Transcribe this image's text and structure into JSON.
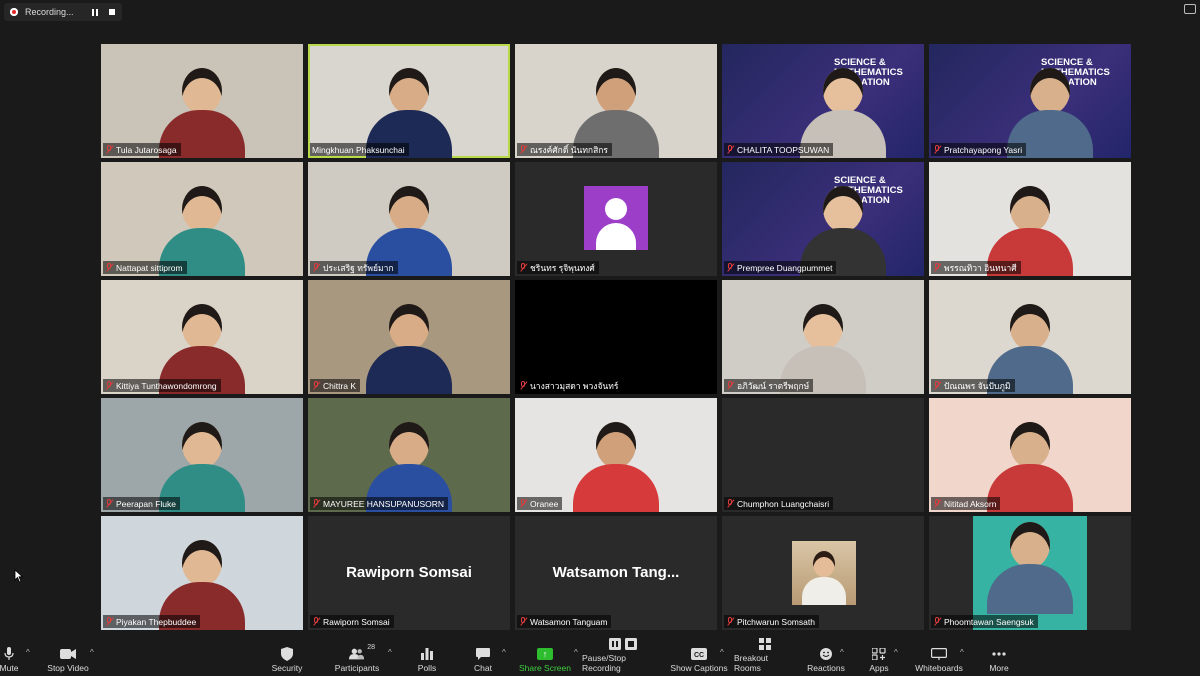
{
  "recording": {
    "label": "Recording..."
  },
  "tiles": [
    {
      "name": "Tula Jutarosaga",
      "muted": true,
      "bg": "#c9c3b8"
    },
    {
      "name": "Mingkhuan Phaksunchai",
      "muted": false,
      "bg": "#d9d6d0",
      "active": true
    },
    {
      "name": "ณรงค์ศักดิ์ นันทกสิกร",
      "muted": true,
      "bg": "#d8d4cc"
    },
    {
      "name": "CHALITA TOOPSUWAN",
      "muted": true,
      "bg": "#2c2f6e",
      "banner": true
    },
    {
      "name": "Pratchayapong Yasri",
      "muted": true,
      "bg": "#2c2f6e",
      "banner": true
    },
    {
      "name": "Nattapat sittiprom",
      "muted": true,
      "bg": "#cfc8bb"
    },
    {
      "name": "ประเสริฐ ทรัพย์มาก",
      "muted": true,
      "bg": "#cfcac2"
    },
    {
      "name": "ชรินทร รุจิพุนทงศ์",
      "muted": true,
      "bg": "#2a2a2a",
      "avatar": true
    },
    {
      "name": "Prempree Duangpummet",
      "muted": true,
      "bg": "#2c2f6e",
      "banner": true
    },
    {
      "name": "พรรณทิวา อินทนาศี",
      "muted": true,
      "bg": "#e4e2de"
    },
    {
      "name": "Kittiya Tunthawondomrong",
      "muted": true,
      "bg": "#d9d3c8"
    },
    {
      "name": "Chittra K",
      "muted": true,
      "bg": "#a89880"
    },
    {
      "name": "นางสาวมุสดา พวงจันทร์",
      "muted": true,
      "bg": "#000000",
      "black": true
    },
    {
      "name": "อภิวัฒน์ ราตรีพฤกษ์",
      "muted": true,
      "bg": "#d0ccc6"
    },
    {
      "name": "ปัณณพร จันปับภูมิ",
      "muted": true,
      "bg": "#dcd8d0"
    },
    {
      "name": "Peerapan Fluke",
      "muted": true,
      "bg": "#9da6a8"
    },
    {
      "name": "MAYUREE HANSUPANUSORN",
      "muted": true,
      "bg": "#5e6a4c"
    },
    {
      "name": "Oranee",
      "muted": true,
      "bg": "#e6e4e2"
    },
    {
      "name": "Chumphon Luangchaisri",
      "muted": true,
      "bg": "#2a2a2a",
      "blank": true
    },
    {
      "name": "Nititad Aksorn",
      "muted": true,
      "bg": "#f1d6cc"
    },
    {
      "name": "Piyakan Thepbuddee",
      "muted": true,
      "bg": "#cfd6dc"
    },
    {
      "name": "Rawiporn  Somsai",
      "muted": true,
      "bg": "#2a2a2a",
      "big": "Rawiporn  Somsai"
    },
    {
      "name": "Watsamon Tanguam",
      "muted": true,
      "bg": "#2a2a2a",
      "big": "Watsamon  Tang..."
    },
    {
      "name": "Pitchwarun Somsath",
      "muted": true,
      "bg": "#2a2a2a",
      "photo": true
    },
    {
      "name": "Phoomtawan Saengsuk",
      "muted": true,
      "bg": "#2a2a2a",
      "teal": true
    }
  ],
  "toolbar": {
    "mute": "Mute",
    "stop_video": "Stop Video",
    "security": "Security",
    "participants": "Participants",
    "participants_count": "28",
    "polls": "Polls",
    "chat": "Chat",
    "share_screen": "Share Screen",
    "pause_stop_recording": "Pause/Stop Recording",
    "show_captions": "Show Captions",
    "breakout_rooms": "Breakout Rooms",
    "reactions": "Reactions",
    "apps": "Apps",
    "whiteboards": "Whiteboards",
    "more": "More"
  },
  "banner": {
    "line1": "SCIENCE &",
    "line2": "MATHEMATICS",
    "line3": "EDUCATION"
  },
  "colors": {
    "accent_green": "#2ebd2e",
    "active_border": "#b8d94a",
    "muted_red": "#e23b3b",
    "avatar_purple": "#9c3ec8"
  }
}
